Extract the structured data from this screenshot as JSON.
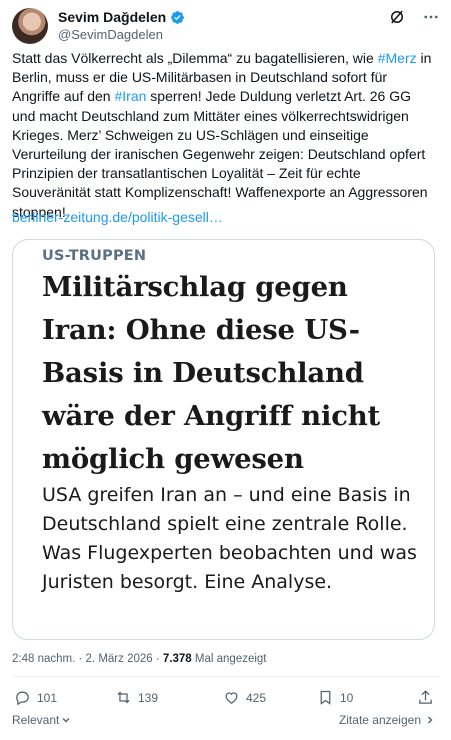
{
  "author": {
    "name": "Sevim Dağdelen",
    "handle": "@SevimDagdelen"
  },
  "header_icons": [
    "grok-icon",
    "more-icon"
  ],
  "tweet": {
    "text_parts": [
      "Statt das Völkerrecht als „Dilemma“ zu bagatellisieren, wie ",
      "#Merz",
      " in Berlin, muss er die US-Militärbasen in Deutschland sofort für Angriffe auf den ",
      "#Iran",
      " sperren! Jede Duldung verletzt Art. 26 GG und macht Deutschland zum Mittäter eines völkerrechtswidrigen Krieges. Merz’ Schweigen zu US-Schlägen und einseitige Verurteilung der iranischen Gegenwehr zeigen: Deutschland opfert Prinzipien der transatlantischen Loyalität – Zeit für echte Souveränität statt Komplizenschaft! Waffenexporte an Aggressoren stoppen!"
    ],
    "link": "berliner-zeitung.de/politik-gesell…"
  },
  "card": {
    "kicker": "US-TRUPPEN",
    "headline": "Militärschlag gegen Iran: Ohne diese US-Basis in Deutschland wäre der Angriff nicht möglich gewesen",
    "subline": "USA greifen Iran an – und eine Basis in Deutschland spielt eine zentrale Rolle. Was Flugexperten beobachten und was Juristen besorgt. Eine Analyse."
  },
  "meta": {
    "time": "2:48 nachm.",
    "sep1": "·",
    "date": "2. März 2026",
    "sep2": "·",
    "views": "7.378",
    "views_label": "Mal angezeigt"
  },
  "actions": {
    "replies": "101",
    "reposts": "139",
    "likes": "425",
    "bookmarks": "10"
  },
  "footer": {
    "sort": "Relevant",
    "quotes": "Zitate anzeigen"
  },
  "colors": {
    "accent": "#1d9bf0",
    "muted": "#536471",
    "border": "#cfd9de"
  }
}
